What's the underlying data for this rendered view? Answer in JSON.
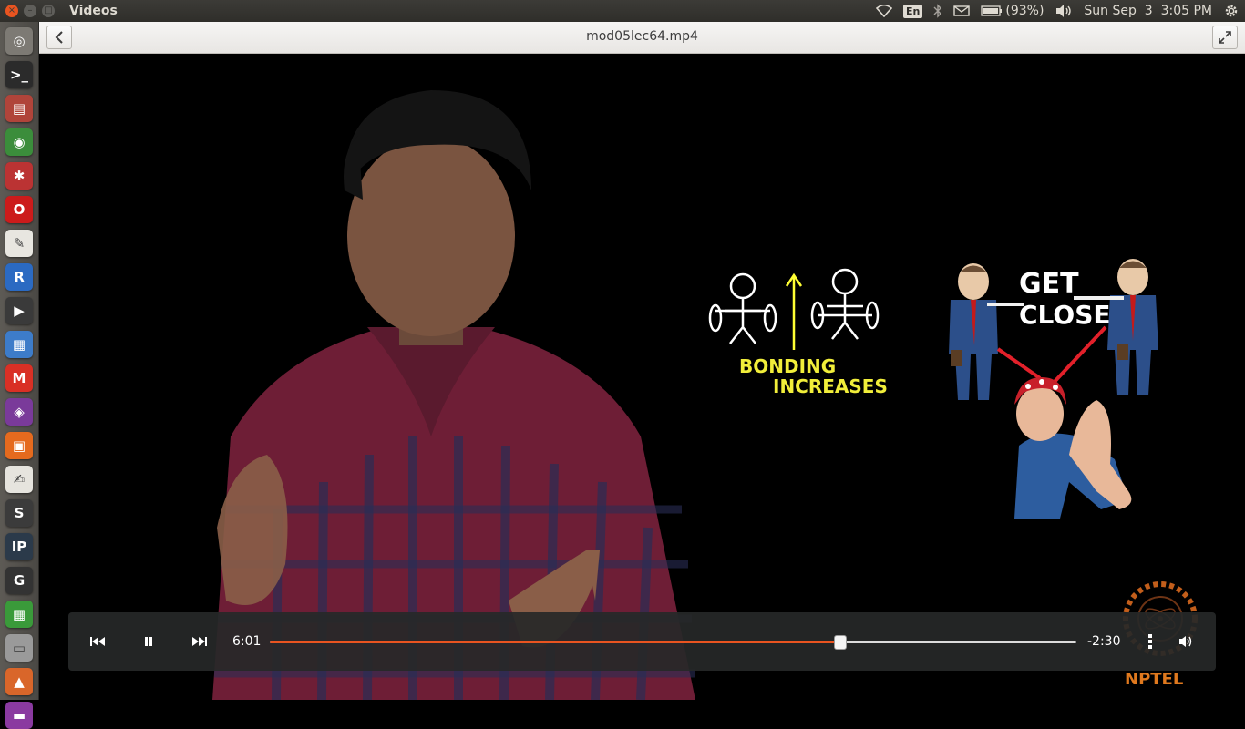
{
  "top_panel": {
    "app_title": "Videos",
    "keyboard_layout": "En",
    "battery_percent": "(93%)",
    "clock": "Sun Sep  3  3:05 PM",
    "icons": [
      "wifi-icon",
      "keyboard-icon",
      "bluetooth-icon",
      "mail-icon",
      "battery-icon",
      "volume-icon",
      "settings-gear-icon"
    ]
  },
  "launcher": {
    "items": [
      {
        "name": "dash-home",
        "glyph": "◎",
        "color": "#7d7a74"
      },
      {
        "name": "terminal",
        "glyph": ">_",
        "color": "#2b2b2b"
      },
      {
        "name": "archive-manager",
        "glyph": "▤",
        "color": "#b0443a"
      },
      {
        "name": "chrome",
        "glyph": "◉",
        "color": "#3b8d3b"
      },
      {
        "name": "system-settings",
        "glyph": "✱",
        "color": "#b33"
      },
      {
        "name": "opera",
        "glyph": "O",
        "color": "#cc1b1b"
      },
      {
        "name": "document-viewer",
        "glyph": "✎",
        "color": "#e8e6e0"
      },
      {
        "name": "r-studio",
        "glyph": "R",
        "color": "#2b6ac2"
      },
      {
        "name": "video-player",
        "glyph": "▶",
        "color": "#3a3a3a"
      },
      {
        "name": "writer",
        "glyph": "▦",
        "color": "#3d7cc9"
      },
      {
        "name": "gmail",
        "glyph": "M",
        "color": "#d93025"
      },
      {
        "name": "media-app",
        "glyph": "◈",
        "color": "#7a3a9a"
      },
      {
        "name": "impress",
        "glyph": "▣",
        "color": "#e56a1e"
      },
      {
        "name": "text-editor",
        "glyph": "✍",
        "color": "#e6e4de"
      },
      {
        "name": "sublime-text",
        "glyph": "S",
        "color": "#3b3b3b"
      },
      {
        "name": "ipython",
        "glyph": "IP",
        "color": "#2b3a4a"
      },
      {
        "name": "geogebra",
        "glyph": "G",
        "color": "#333"
      },
      {
        "name": "calc",
        "glyph": "▦",
        "color": "#3a9a3a"
      },
      {
        "name": "drive",
        "glyph": "▭",
        "color": "#9a9a9a"
      },
      {
        "name": "app-extra",
        "glyph": "▲",
        "color": "#d9662a"
      },
      {
        "name": "app-extra-2",
        "glyph": "▬",
        "color": "#8a3aa0"
      }
    ]
  },
  "header": {
    "title": "mod05lec64.mp4"
  },
  "video_overlay": {
    "bonding_text_1": "BONDING",
    "bonding_text_2": "INCREASES",
    "get_text": "GET",
    "close_text": "CLOSE",
    "watermark": "NPTEL"
  },
  "player": {
    "elapsed": "6:01",
    "remaining": "-2:30",
    "progress_fraction": 0.706
  },
  "colors": {
    "accent": "#e95420",
    "controls_bg": "#262828"
  }
}
